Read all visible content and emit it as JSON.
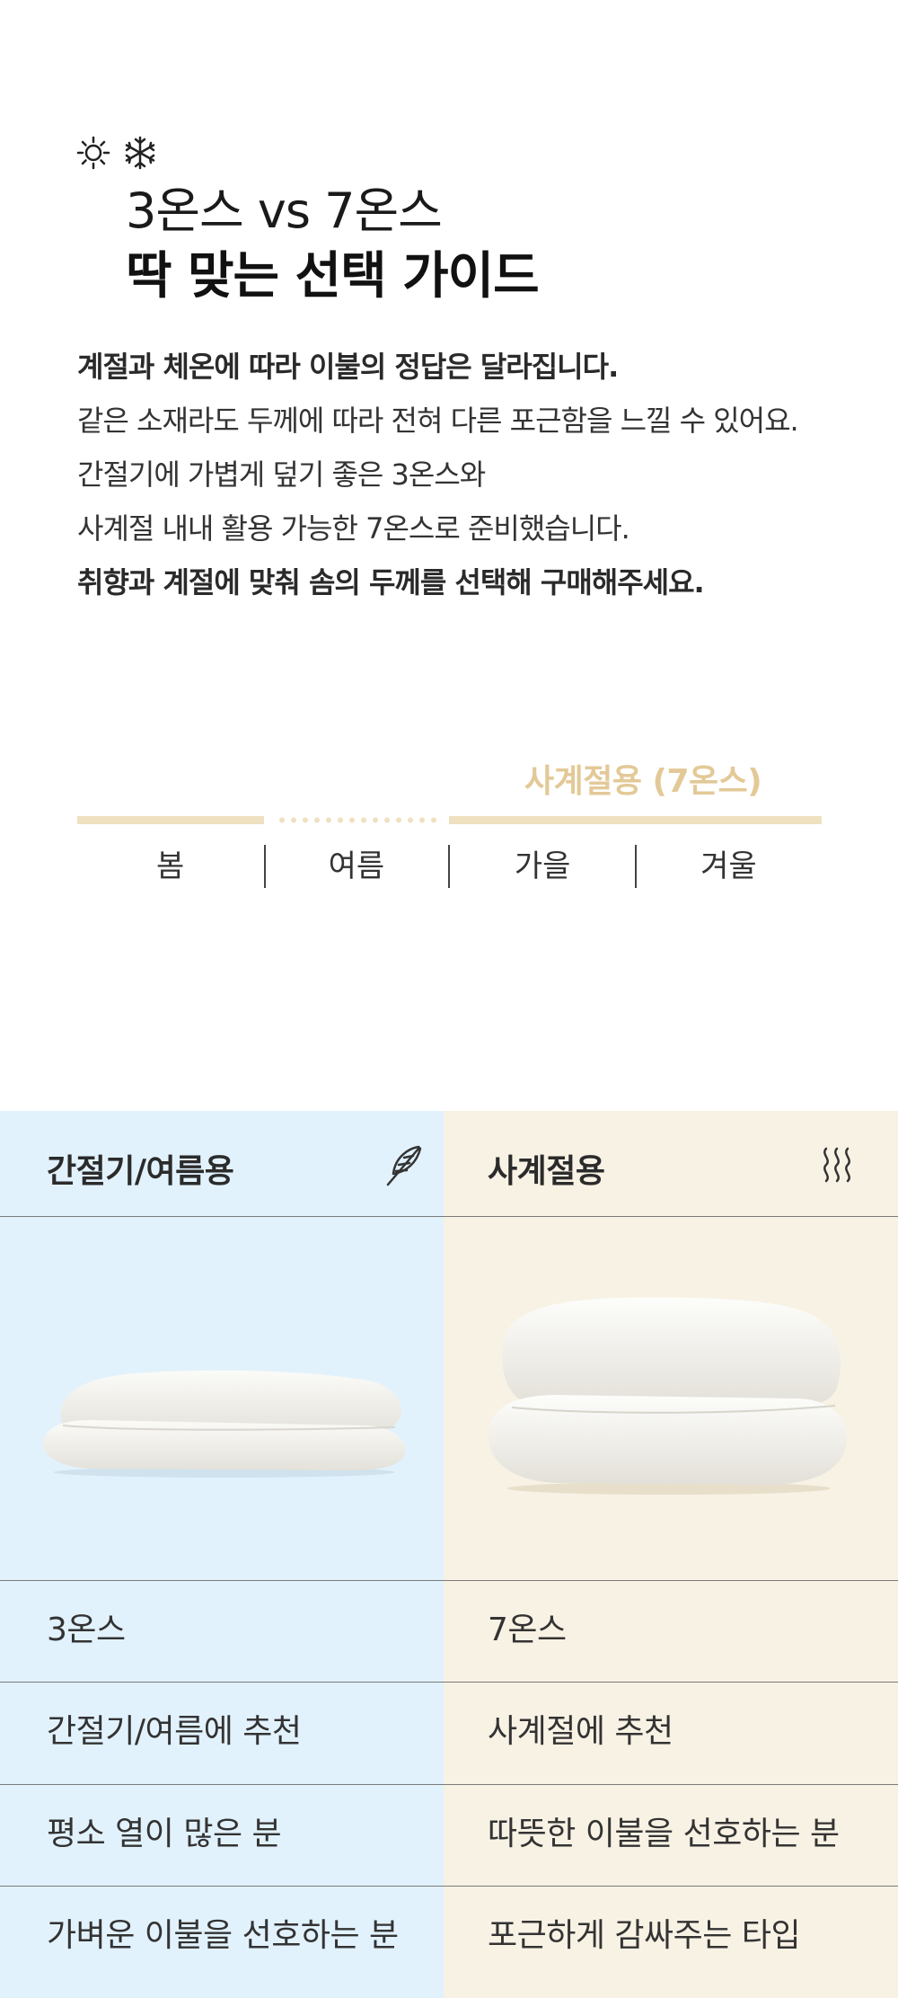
{
  "header": {
    "icon_sun": "sun-icon",
    "icon_snow": "snowflake-icon",
    "title_line1": "3온스 vs 7온스",
    "title_line2": "딱 맞는 선택 가이드"
  },
  "description": [
    "계절과 체온에 따라 이불의 정답은 달라집니다.",
    "같은 소재라도 두께에 따라 전혀 다른 포근함을 느낄 수 있어요.",
    "간절기에 가볍게 덮기 좋은 3온스와",
    "사계절 내내 활용 가능한 7온스로 준비했습니다.",
    "취향과 계절에 맞춰 솜의 두께를 선택해 구매해주세요."
  ],
  "season_chart": {
    "highlight_label": "사계절용 (7온스)",
    "seasons": [
      "봄",
      "여름",
      "가을",
      "겨울"
    ],
    "accent_color": "#e3c997"
  },
  "comparison": {
    "left": {
      "header": "간절기/여름용",
      "icon": "feather-icon",
      "rows": [
        "3온스",
        "간절기/여름에 추천",
        "평소 열이 많은 분",
        "가벼운 이불을 선호하는 분"
      ],
      "bg_color": "#e2f2fd"
    },
    "right": {
      "header": "사계절용",
      "icon": "heat-waves-icon",
      "rows": [
        "7온스",
        "사계절에 추천",
        "따뜻한 이불을 선호하는 분",
        "포근하게 감싸주는 타입"
      ],
      "bg_color": "#f8f2e5"
    }
  }
}
